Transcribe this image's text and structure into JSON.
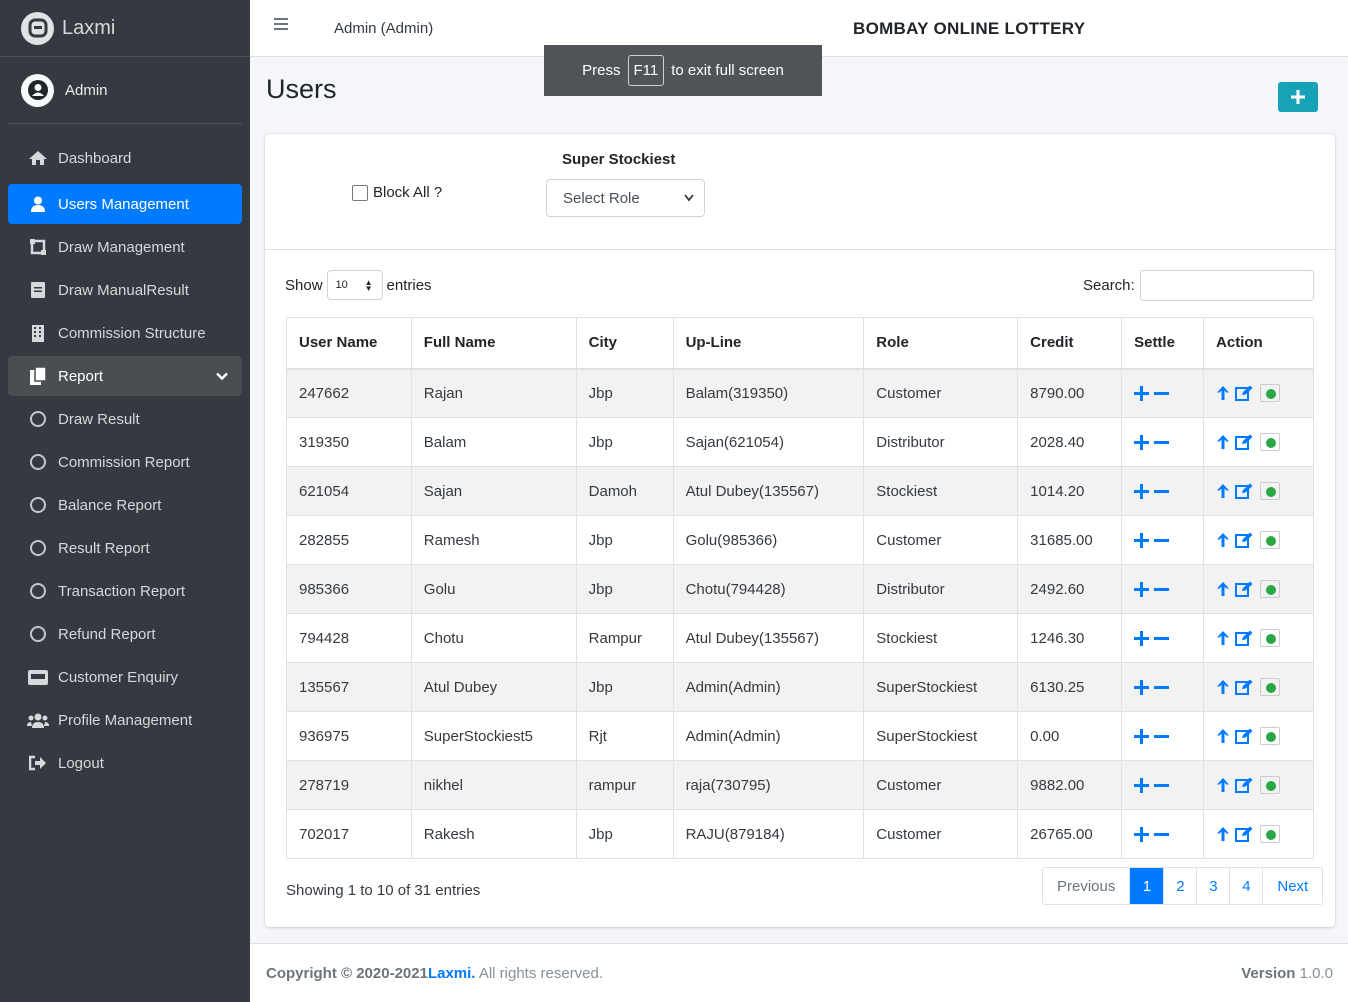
{
  "brand": {
    "name": "Laxmi"
  },
  "sidebar": {
    "user": "Admin",
    "items": [
      {
        "label": "Dashboard",
        "icon": "home-icon",
        "state": ""
      },
      {
        "label": "Users Management",
        "icon": "user-icon",
        "state": "active"
      },
      {
        "label": "Draw Management",
        "icon": "draw-icon",
        "state": ""
      },
      {
        "label": "Draw ManualResult",
        "icon": "file-icon",
        "state": ""
      },
      {
        "label": "Commission Structure",
        "icon": "building-icon",
        "state": ""
      },
      {
        "label": "Report",
        "icon": "copy-icon",
        "state": "open"
      },
      {
        "label": "Draw Result",
        "icon": "circle-icon",
        "state": "sub"
      },
      {
        "label": "Commission Report",
        "icon": "circle-icon",
        "state": "sub"
      },
      {
        "label": "Balance Report",
        "icon": "circle-icon",
        "state": "sub"
      },
      {
        "label": "Result Report",
        "icon": "circle-icon",
        "state": "sub"
      },
      {
        "label": "Transaction Report",
        "icon": "circle-icon",
        "state": "sub"
      },
      {
        "label": "Refund Report",
        "icon": "circle-icon",
        "state": "sub"
      },
      {
        "label": "Customer Enquiry",
        "icon": "id-card-icon",
        "state": ""
      },
      {
        "label": "Profile Management",
        "icon": "users-icon",
        "state": ""
      },
      {
        "label": "Logout",
        "icon": "logout-icon",
        "state": ""
      }
    ]
  },
  "topbar": {
    "user": "Admin (Admin)",
    "title": "BOMBAY ONLINE LOTTERY"
  },
  "fullscreen_toast": {
    "prefix": "Press",
    "key": "F11",
    "suffix": "to exit full screen"
  },
  "page": {
    "title": "Users"
  },
  "filters": {
    "block_all_label": "Block All ?",
    "super_stockiest_label": "Super Stockiest",
    "role_select_value": "Select Role"
  },
  "datatable": {
    "show_label": "Show",
    "length_value": "10",
    "entries_label": "entries",
    "search_label": "Search:",
    "search_value": "",
    "columns": [
      "User Name",
      "Full Name",
      "City",
      "Up-Line",
      "Role",
      "Credit",
      "Settle",
      "Action"
    ],
    "rows": [
      [
        "247662",
        "Rajan",
        "Jbp",
        "Balam(319350)",
        "Customer",
        "8790.00"
      ],
      [
        "319350",
        "Balam",
        "Jbp",
        "Sajan(621054)",
        "Distributor",
        "2028.40"
      ],
      [
        "621054",
        "Sajan",
        "Damoh",
        "Atul Dubey(135567)",
        "Stockiest",
        "1014.20"
      ],
      [
        "282855",
        "Ramesh",
        "Jbp",
        "Golu(985366)",
        "Customer",
        "31685.00"
      ],
      [
        "985366",
        "Golu",
        "Jbp",
        "Chotu(794428)",
        "Distributor",
        "2492.60"
      ],
      [
        "794428",
        "Chotu",
        "Rampur",
        "Atul Dubey(135567)",
        "Stockiest",
        "1246.30"
      ],
      [
        "135567",
        "Atul Dubey",
        "Jbp",
        "Admin(Admin)",
        "SuperStockiest",
        "6130.25"
      ],
      [
        "936975",
        "SuperStockiest5",
        "Rjt",
        "Admin(Admin)",
        "SuperStockiest",
        "0.00"
      ],
      [
        "278719",
        "nikhel",
        "rampur",
        "raja(730795)",
        "Customer",
        "9882.00"
      ],
      [
        "702017",
        "Rakesh",
        "Jbp",
        "RAJU(879184)",
        "Customer",
        "26765.00"
      ]
    ],
    "info": "Showing 1 to 10 of 31 entries",
    "pagination": {
      "previous": "Previous",
      "pages": [
        "1",
        "2",
        "3",
        "4"
      ],
      "current": "1",
      "next": "Next"
    }
  },
  "footer": {
    "copyright": "Copyright © 2020-2021",
    "brand": "Laxmi.",
    "rights": " All rights reserved.",
    "version_label": "Version",
    "version": "1.0.0"
  },
  "colors": {
    "sidebar_bg": "#343a40",
    "primary": "#007bff",
    "info": "#17a2b8",
    "success": "#28a745"
  }
}
